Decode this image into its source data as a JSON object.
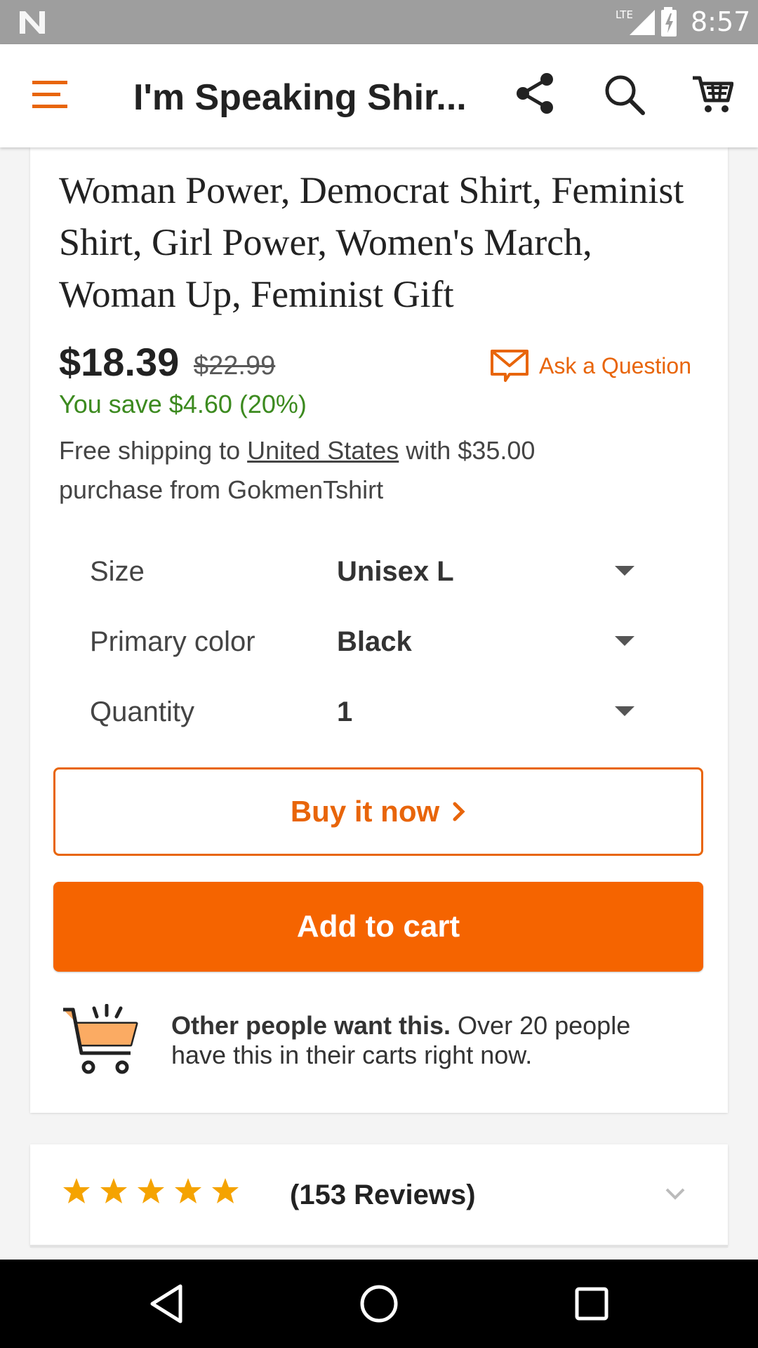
{
  "status_bar": {
    "network_label": "LTE",
    "time": "8:57"
  },
  "appbar": {
    "title": "I'm Speaking Shir...",
    "icons": [
      "menu-icon",
      "share-icon",
      "search-icon",
      "cart-icon"
    ],
    "accent_color": "#e8650a"
  },
  "product": {
    "title_lines": [
      "Woman Power, Democrat Shirt, Feminist",
      "Shirt, Girl Power, Women's March,",
      "Woman Up, Feminist Gift"
    ],
    "price": "$18.39",
    "original_price": "$22.99",
    "ask_question": "Ask a Question",
    "savings": "You save $4.60 (20%)",
    "shipping_prefix": "Free shipping to ",
    "shipping_country": "United States",
    "shipping_suffix": " with $35.00",
    "shipping_line2": "purchase from GokmenTshirt"
  },
  "options": [
    {
      "label": "Size",
      "value": "Unisex L"
    },
    {
      "label": "Primary color",
      "value": "Black"
    },
    {
      "label": "Quantity",
      "value": "1"
    }
  ],
  "buttons": {
    "buy_now": "Buy it now",
    "add_to_cart": "Add to cart",
    "primary_color": "#f56400"
  },
  "social_proof": {
    "bold": "Other people want this.",
    "rest": " Over 20 people have this in their carts right now."
  },
  "reviews": {
    "rating_stars": 5,
    "label": "(153 Reviews)",
    "star_color": "#f5a300"
  }
}
